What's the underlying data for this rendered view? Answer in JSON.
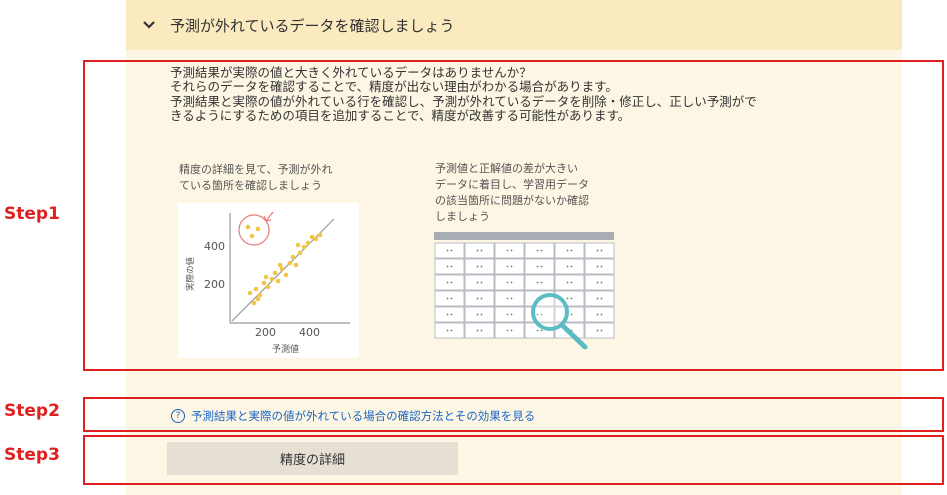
{
  "panel": {
    "title": "予測が外れているデータを確認しましょう"
  },
  "description": {
    "lines": [
      "予測結果が実際の値と大きく外れているデータはありませんか？",
      "それらのデータを確認することで、精度が出ない理由がわかる場合があります。",
      "予測結果と実際の値が外れている行を確認し、予測が外れているデータを削除・修正し、正しい予測がで",
      "きるようにするための項目を追加することで、精度が改善する可能性があります。"
    ]
  },
  "illustration_left": {
    "caption_lines": [
      "精度の詳細を見て、予測が外れ",
      "ている箇所を確認しましょう"
    ],
    "y_axis_label": "実際の値",
    "x_axis_label": "予測値",
    "y_ticks": [
      "400",
      "200"
    ],
    "x_ticks": [
      "200",
      "400"
    ]
  },
  "illustration_right": {
    "caption_lines": [
      "予測値と正解値の差が大きい",
      "データに着目し、学習用データ",
      "の該当箇所に問題がないか確認",
      "しましょう"
    ]
  },
  "help_link": {
    "text": "予測結果と実際の値が外れている場合の確認方法とその効果を見る"
  },
  "detail_button": {
    "label": "精度の詳細"
  },
  "steps": {
    "step1": "Step1",
    "step2": "Step2",
    "step3": "Step3"
  },
  "colors": {
    "header_bg": "#fbe9c0",
    "panel_bg": "#fdf6e4",
    "step_red": "#e02020",
    "link_blue": "#1a66c4",
    "dot_yellow": "#f2c548",
    "magnifier_teal": "#5bbcc6"
  },
  "icons": {
    "chevron": "chevron-down-icon",
    "help": "question-circle-icon",
    "magnifier": "magnifier-icon"
  }
}
